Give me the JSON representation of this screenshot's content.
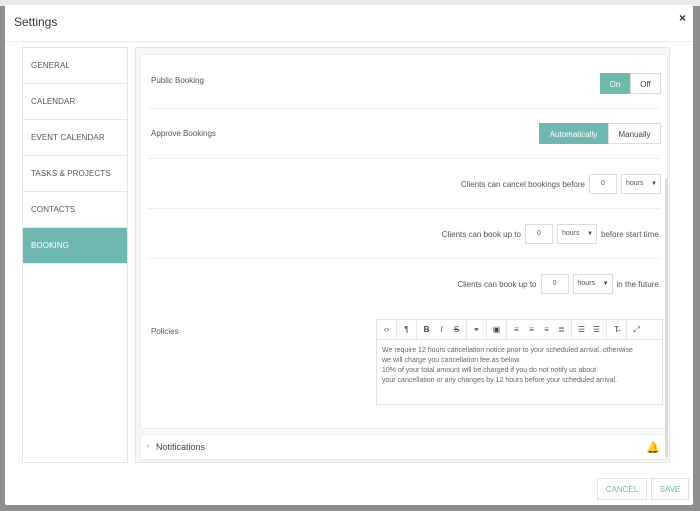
{
  "modal": {
    "title": "Settings",
    "close": "×"
  },
  "sidebar": {
    "items": [
      {
        "label": "GENERAL"
      },
      {
        "label": "CALENDAR"
      },
      {
        "label": "EVENT CALENDAR"
      },
      {
        "label": "TASKS & PROJECTS"
      },
      {
        "label": "CONTACTS"
      },
      {
        "label": "BOOKING",
        "active": true
      }
    ]
  },
  "booking": {
    "public_booking": {
      "label": "Public Booking",
      "on": "On",
      "off": "Off",
      "selected": "On"
    },
    "approve_bookings": {
      "label": "Approve Bookings",
      "automatic": "Automatically",
      "manual": "Manually",
      "selected": "Automatically"
    },
    "cancel": {
      "label": "Clients can cancel bookings before",
      "value": "0",
      "unit": "hours"
    },
    "book_before": {
      "label": "Clients can book up to",
      "value": "0",
      "unit": "hours",
      "suffix": "before start time."
    },
    "book_future": {
      "label": "Clients can book up to",
      "value": "0",
      "unit": "hours",
      "suffix": "in the future."
    },
    "policies": {
      "label": "Policies",
      "text_lines": [
        "We require 12 hours cancellation notice prior to your scheduled arrival, otherwise",
        "we will charge you cancellation fee as below.",
        "10% of your total amount will be charged if you do not notify us about",
        "your cancellation or any changes by 12 hours before your scheduled arrival."
      ]
    }
  },
  "notifications": {
    "label": "Notifications"
  },
  "footer": {
    "cancel": "CANCEL",
    "save": "SAVE"
  },
  "colors": {
    "accent": "#6fb8b0"
  },
  "icons": {
    "toolbar": [
      "code-icon",
      "paragraph-icon",
      "bold-icon",
      "italic-icon",
      "strikethrough-icon",
      "link-icon",
      "image-icon",
      "align-left-icon",
      "align-center-icon",
      "align-right-icon",
      "align-justify-icon",
      "bullet-list-icon",
      "numbered-list-icon",
      "clear-format-icon",
      "fullscreen-icon"
    ]
  }
}
